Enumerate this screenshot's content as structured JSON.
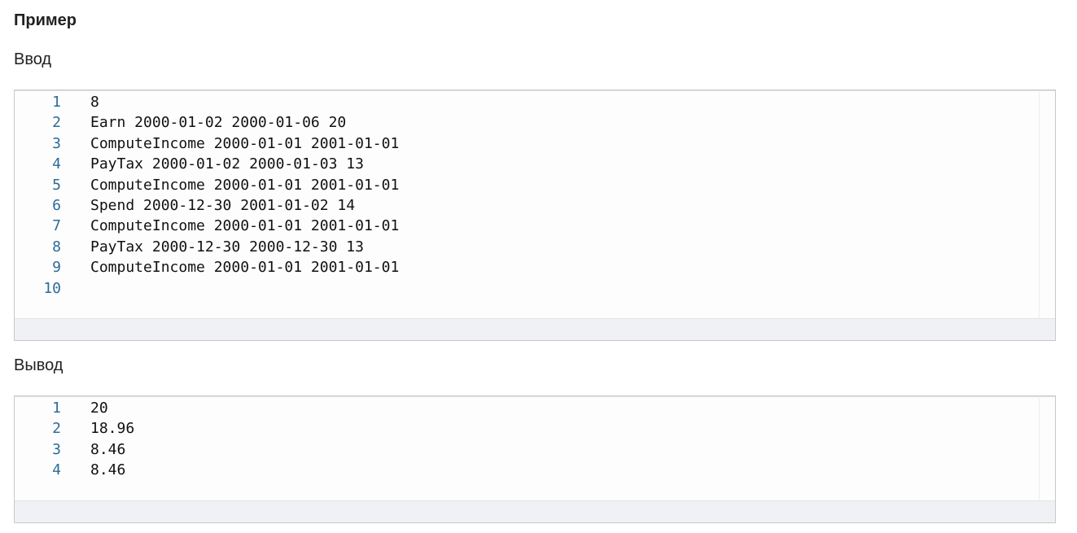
{
  "example": {
    "title": "Пример",
    "input": {
      "label": "Ввод",
      "lines": [
        {
          "number": "1",
          "text": "8"
        },
        {
          "number": "2",
          "text": "Earn 2000-01-02 2000-01-06 20"
        },
        {
          "number": "3",
          "text": "ComputeIncome 2000-01-01 2001-01-01"
        },
        {
          "number": "4",
          "text": "PayTax 2000-01-02 2000-01-03 13"
        },
        {
          "number": "5",
          "text": "ComputeIncome 2000-01-01 2001-01-01"
        },
        {
          "number": "6",
          "text": "Spend 2000-12-30 2001-01-02 14"
        },
        {
          "number": "7",
          "text": "ComputeIncome 2000-01-01 2001-01-01"
        },
        {
          "number": "8",
          "text": "PayTax 2000-12-30 2000-12-30 13"
        },
        {
          "number": "9",
          "text": "ComputeIncome 2000-01-01 2001-01-01"
        },
        {
          "number": "10",
          "text": ""
        }
      ]
    },
    "output": {
      "label": "Вывод",
      "lines": [
        {
          "number": "1",
          "text": "20"
        },
        {
          "number": "2",
          "text": "18.96"
        },
        {
          "number": "3",
          "text": "8.46"
        },
        {
          "number": "4",
          "text": "8.46"
        }
      ]
    }
  }
}
